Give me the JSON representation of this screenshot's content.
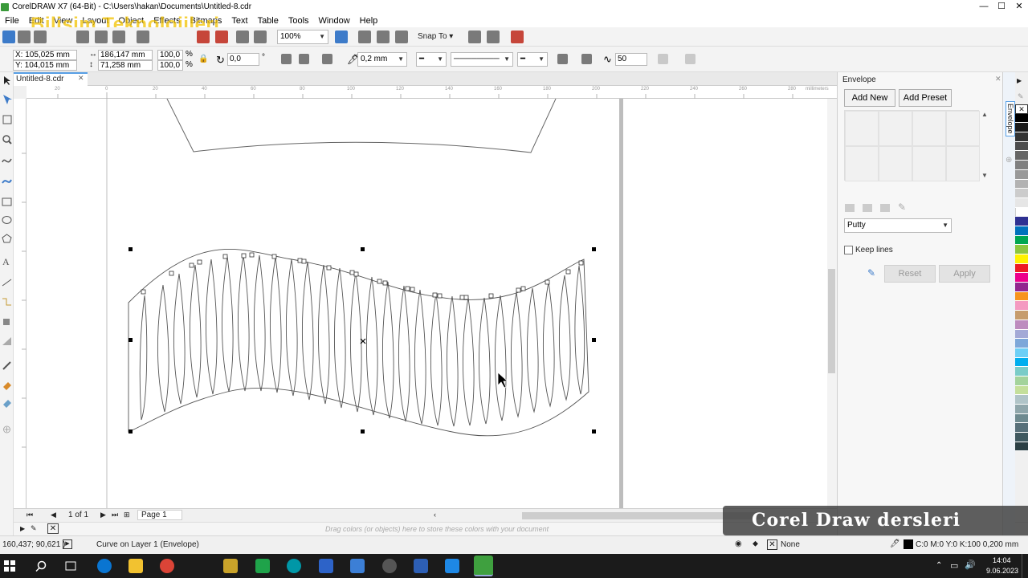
{
  "window": {
    "title": "CorelDRAW X7 (64-Bit) - C:\\Users\\hakan\\Documents\\Untitled-8.cdr",
    "min": "—",
    "max": "☐",
    "close": "✕"
  },
  "menu": [
    "File",
    "Edit",
    "View",
    "Layout",
    "Object",
    "Effects",
    "Bitmaps",
    "Text",
    "Table",
    "Tools",
    "Window",
    "Help"
  ],
  "overlay_banner": "Bilişim Teknolojileri",
  "toolbar": {
    "zoom": "100%",
    "snap_to": "Snap To"
  },
  "propbar": {
    "x": "X: 105,025 mm",
    "y": "Y: 104,015 mm",
    "w": "186,147 mm",
    "h": "71,258 mm",
    "sx": "100,0",
    "sy": "100,0",
    "pct": "%",
    "angle": "0,0",
    "deg": "°",
    "outline": "0,2 mm",
    "nodes": "50"
  },
  "document": {
    "tab": "Untitled-8.cdr",
    "ruler_units": "millimeters",
    "ruler_ticks": [
      "20",
      "0",
      "20",
      "40",
      "60",
      "80",
      "100",
      "120",
      "140",
      "160",
      "180",
      "200",
      "220",
      "240",
      "260",
      "280"
    ]
  },
  "pages": {
    "counter": "1 of 1",
    "tab": "Page 1"
  },
  "palette_hint": "Drag colors (or objects) here to store these colors with your document",
  "status": {
    "coords": "160,437; 90,621 )",
    "object": "Curve on Layer 1  (Envelope)",
    "fill": "None",
    "outline": "C:0 M:0 Y:0 K:100  0,200 mm"
  },
  "docker": {
    "title": "Envelope",
    "tab_label": "Envelope",
    "add_new": "Add New",
    "add_preset": "Add Preset",
    "mode": "Putty",
    "keep_lines": "Keep lines",
    "reset": "Reset",
    "apply": "Apply"
  },
  "watermark": "Corel Draw dersleri",
  "taskbar": {
    "time": "14:04",
    "date": "9.06.2023"
  },
  "colors": {
    "accent": "#58a0e6",
    "selection": "#000000"
  }
}
